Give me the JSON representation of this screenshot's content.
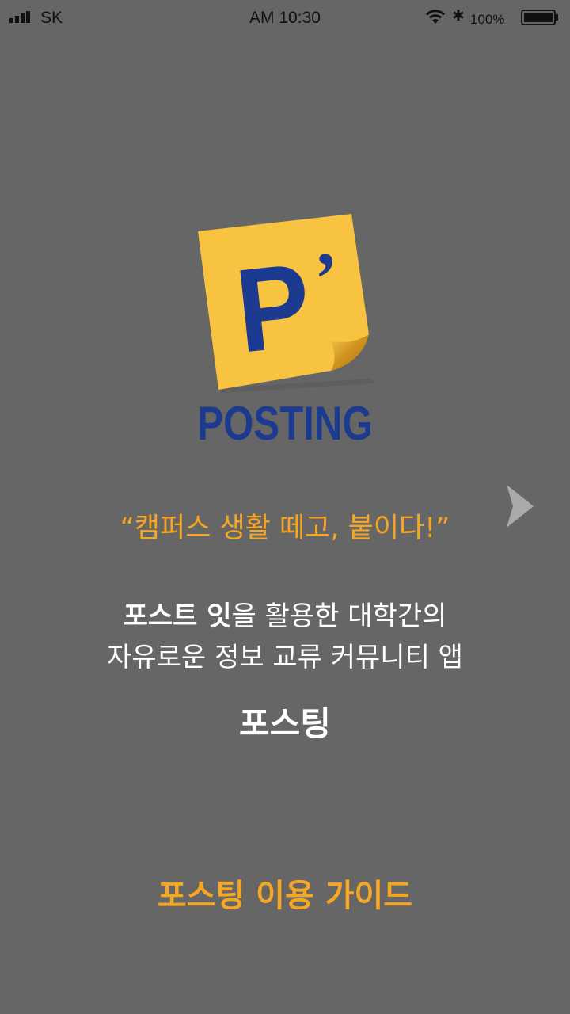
{
  "status_bar": {
    "carrier": "SK",
    "time": "AM 10:30",
    "bluetooth_symbol": "✱",
    "battery": "100%"
  },
  "logo": {
    "mark": "P",
    "apostrophe": "’",
    "wordmark": "POSTING",
    "colors": {
      "note": "#f7c340",
      "curl": "#b87d1a",
      "text": "#1c3a8f"
    }
  },
  "tagline": "“캠퍼스 생활 떼고, 붙이다!”",
  "description": {
    "line1_bold": "포스트 잇",
    "line1_rest": "을 활용한 대학간의",
    "line2": "자유로운 정보 교류 커뮤니티 앱"
  },
  "app_name": "포스팅",
  "guide_link": "포스팅 이용 가이드",
  "icons": {
    "signal": "signal-icon",
    "wifi": "wifi-icon",
    "bluetooth": "bluetooth-icon",
    "battery": "battery-icon",
    "next": "chevron-right-icon"
  },
  "colors": {
    "background": "#666666",
    "accent": "#f5a623",
    "text": "#ffffff"
  }
}
